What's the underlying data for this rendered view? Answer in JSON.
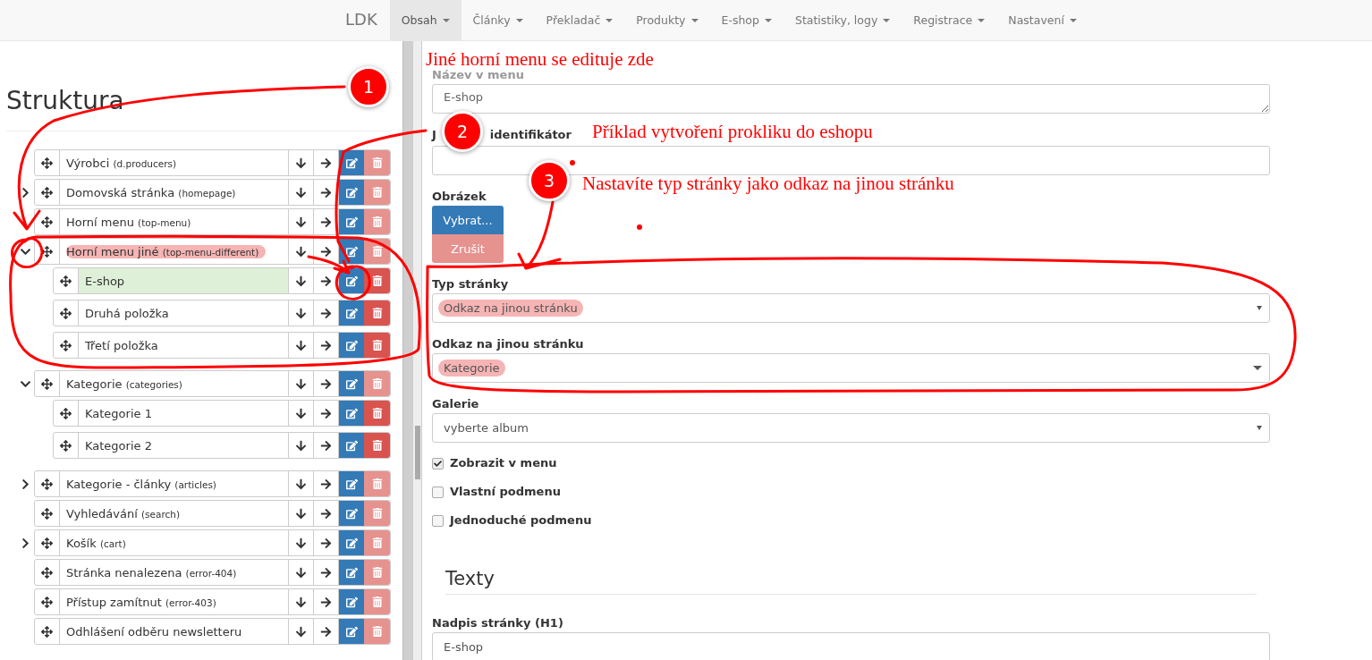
{
  "navbar": {
    "brand": "LDK",
    "items": [
      {
        "label": "Obsah",
        "selected": true
      },
      {
        "label": "Články",
        "selected": false
      },
      {
        "label": "Překladač",
        "selected": false
      },
      {
        "label": "Produkty",
        "selected": false
      },
      {
        "label": "E-shop",
        "selected": false
      },
      {
        "label": "Statistiky, logy",
        "selected": false
      },
      {
        "label": "Registrace",
        "selected": false
      },
      {
        "label": "Nastavení",
        "selected": false
      }
    ]
  },
  "structure": {
    "title": "Struktura",
    "items": [
      {
        "name": "Výrobci",
        "slug": "(d.producers)",
        "selected": false,
        "highlighted": false,
        "delete_disabled": true
      },
      {
        "name": "Domovská stránka",
        "slug": "(homepage)",
        "expanded": false,
        "selected": false,
        "highlighted": false,
        "delete_disabled": true
      },
      {
        "name": "Horní menu",
        "slug": "(top-menu)",
        "selected": false,
        "highlighted": false,
        "delete_disabled": true
      },
      {
        "name": "Horní menu jiné",
        "slug": "(top-menu-different)",
        "expanded": true,
        "selected": false,
        "highlighted": true,
        "delete_disabled": true,
        "children": [
          {
            "name": "E-shop",
            "selected": true,
            "highlighted": false,
            "delete_disabled": false
          },
          {
            "name": "Druhá položka",
            "selected": false,
            "highlighted": false,
            "delete_disabled": false
          },
          {
            "name": "Třetí položka",
            "selected": false,
            "highlighted": false,
            "delete_disabled": false
          }
        ]
      },
      {
        "name": "Kategorie",
        "slug": "(categories)",
        "expanded": true,
        "selected": false,
        "highlighted": false,
        "delete_disabled": true,
        "children": [
          {
            "name": "Kategorie 1",
            "selected": false,
            "highlighted": false,
            "delete_disabled": false
          },
          {
            "name": "Kategorie 2",
            "selected": false,
            "highlighted": false,
            "delete_disabled": false
          }
        ]
      },
      {
        "name": "Kategorie - články",
        "slug": "(articles)",
        "expanded": false,
        "selected": false,
        "highlighted": false,
        "delete_disabled": true
      },
      {
        "name": "Vyhledávání",
        "slug": "(search)",
        "selected": false,
        "highlighted": false,
        "delete_disabled": true
      },
      {
        "name": "Košík",
        "slug": "(cart)",
        "expanded": false,
        "selected": false,
        "highlighted": false,
        "delete_disabled": true
      },
      {
        "name": "Stránka nenalezena",
        "slug": "(error-404)",
        "selected": false,
        "highlighted": false,
        "delete_disabled": true
      },
      {
        "name": "Přístup zamítnut",
        "slug": "(error-403)",
        "selected": false,
        "highlighted": false,
        "delete_disabled": true
      },
      {
        "name": "Odhlášení odběru newsletteru",
        "selected": false,
        "highlighted": false,
        "delete_disabled": true
      }
    ]
  },
  "form": {
    "fields": [
      {
        "kind": "textarea",
        "label": "Název v menu",
        "value": "E-shop"
      },
      {
        "kind": "input",
        "label_prefix": "J",
        "label": "identifikátor"
      },
      {
        "kind": "image",
        "label": "Obrázek",
        "buttons": [
          {
            "label": "Vybrat...",
            "disabled": false
          },
          {
            "label": "Zrušit",
            "disabled": true
          }
        ]
      },
      {
        "kind": "select",
        "label": "Typ stránky",
        "value": "Odkaz na jinou stránku",
        "highlighted": true
      },
      {
        "kind": "select2",
        "label": "Odkaz na jinou stránku",
        "value": "Kategorie",
        "highlighted": true
      },
      {
        "kind": "select",
        "label": "Galerie",
        "value": "vyberte album",
        "highlighted": false
      },
      {
        "kind": "checkbox",
        "label": "Zobrazit v menu",
        "checked": true
      },
      {
        "kind": "checkbox",
        "label": "Vlastní podmenu",
        "checked": false
      },
      {
        "kind": "checkbox",
        "label": "Jednoduché podmenu",
        "checked": false
      },
      {
        "kind": "section",
        "label": "Texty"
      },
      {
        "kind": "input",
        "label": "Nadpis stránky (H1)",
        "value": "E-shop"
      }
    ]
  },
  "annotations": [
    {
      "number": "1",
      "text": "Jiné horní menu se edituje zde"
    },
    {
      "number": "2",
      "text": "Příklad vytvoření prokliku do eshopu"
    },
    {
      "number": "3",
      "text": "Nastavíte typ stránky jako odkaz na jinou stránku"
    }
  ]
}
